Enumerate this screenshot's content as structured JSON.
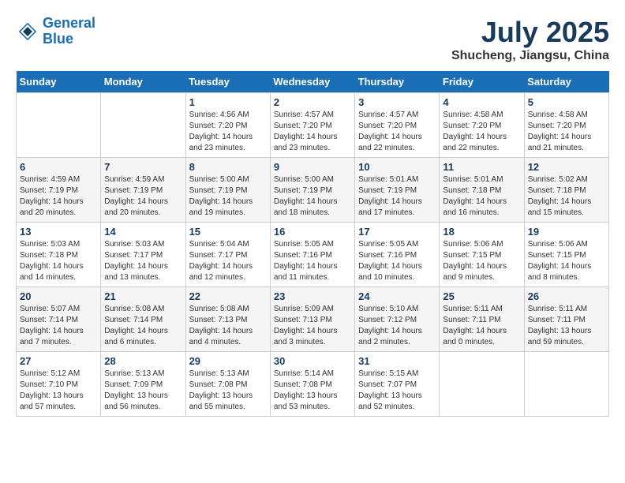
{
  "header": {
    "logo_line1": "General",
    "logo_line2": "Blue",
    "month": "July 2025",
    "location": "Shucheng, Jiangsu, China"
  },
  "days_of_week": [
    "Sunday",
    "Monday",
    "Tuesday",
    "Wednesday",
    "Thursday",
    "Friday",
    "Saturday"
  ],
  "weeks": [
    [
      {
        "day": "",
        "info": ""
      },
      {
        "day": "",
        "info": ""
      },
      {
        "day": "1",
        "info": "Sunrise: 4:56 AM\nSunset: 7:20 PM\nDaylight: 14 hours and 23 minutes."
      },
      {
        "day": "2",
        "info": "Sunrise: 4:57 AM\nSunset: 7:20 PM\nDaylight: 14 hours and 23 minutes."
      },
      {
        "day": "3",
        "info": "Sunrise: 4:57 AM\nSunset: 7:20 PM\nDaylight: 14 hours and 22 minutes."
      },
      {
        "day": "4",
        "info": "Sunrise: 4:58 AM\nSunset: 7:20 PM\nDaylight: 14 hours and 22 minutes."
      },
      {
        "day": "5",
        "info": "Sunrise: 4:58 AM\nSunset: 7:20 PM\nDaylight: 14 hours and 21 minutes."
      }
    ],
    [
      {
        "day": "6",
        "info": "Sunrise: 4:59 AM\nSunset: 7:19 PM\nDaylight: 14 hours and 20 minutes."
      },
      {
        "day": "7",
        "info": "Sunrise: 4:59 AM\nSunset: 7:19 PM\nDaylight: 14 hours and 20 minutes."
      },
      {
        "day": "8",
        "info": "Sunrise: 5:00 AM\nSunset: 7:19 PM\nDaylight: 14 hours and 19 minutes."
      },
      {
        "day": "9",
        "info": "Sunrise: 5:00 AM\nSunset: 7:19 PM\nDaylight: 14 hours and 18 minutes."
      },
      {
        "day": "10",
        "info": "Sunrise: 5:01 AM\nSunset: 7:19 PM\nDaylight: 14 hours and 17 minutes."
      },
      {
        "day": "11",
        "info": "Sunrise: 5:01 AM\nSunset: 7:18 PM\nDaylight: 14 hours and 16 minutes."
      },
      {
        "day": "12",
        "info": "Sunrise: 5:02 AM\nSunset: 7:18 PM\nDaylight: 14 hours and 15 minutes."
      }
    ],
    [
      {
        "day": "13",
        "info": "Sunrise: 5:03 AM\nSunset: 7:18 PM\nDaylight: 14 hours and 14 minutes."
      },
      {
        "day": "14",
        "info": "Sunrise: 5:03 AM\nSunset: 7:17 PM\nDaylight: 14 hours and 13 minutes."
      },
      {
        "day": "15",
        "info": "Sunrise: 5:04 AM\nSunset: 7:17 PM\nDaylight: 14 hours and 12 minutes."
      },
      {
        "day": "16",
        "info": "Sunrise: 5:05 AM\nSunset: 7:16 PM\nDaylight: 14 hours and 11 minutes."
      },
      {
        "day": "17",
        "info": "Sunrise: 5:05 AM\nSunset: 7:16 PM\nDaylight: 14 hours and 10 minutes."
      },
      {
        "day": "18",
        "info": "Sunrise: 5:06 AM\nSunset: 7:15 PM\nDaylight: 14 hours and 9 minutes."
      },
      {
        "day": "19",
        "info": "Sunrise: 5:06 AM\nSunset: 7:15 PM\nDaylight: 14 hours and 8 minutes."
      }
    ],
    [
      {
        "day": "20",
        "info": "Sunrise: 5:07 AM\nSunset: 7:14 PM\nDaylight: 14 hours and 7 minutes."
      },
      {
        "day": "21",
        "info": "Sunrise: 5:08 AM\nSunset: 7:14 PM\nDaylight: 14 hours and 6 minutes."
      },
      {
        "day": "22",
        "info": "Sunrise: 5:08 AM\nSunset: 7:13 PM\nDaylight: 14 hours and 4 minutes."
      },
      {
        "day": "23",
        "info": "Sunrise: 5:09 AM\nSunset: 7:13 PM\nDaylight: 14 hours and 3 minutes."
      },
      {
        "day": "24",
        "info": "Sunrise: 5:10 AM\nSunset: 7:12 PM\nDaylight: 14 hours and 2 minutes."
      },
      {
        "day": "25",
        "info": "Sunrise: 5:11 AM\nSunset: 7:11 PM\nDaylight: 14 hours and 0 minutes."
      },
      {
        "day": "26",
        "info": "Sunrise: 5:11 AM\nSunset: 7:11 PM\nDaylight: 13 hours and 59 minutes."
      }
    ],
    [
      {
        "day": "27",
        "info": "Sunrise: 5:12 AM\nSunset: 7:10 PM\nDaylight: 13 hours and 57 minutes."
      },
      {
        "day": "28",
        "info": "Sunrise: 5:13 AM\nSunset: 7:09 PM\nDaylight: 13 hours and 56 minutes."
      },
      {
        "day": "29",
        "info": "Sunrise: 5:13 AM\nSunset: 7:08 PM\nDaylight: 13 hours and 55 minutes."
      },
      {
        "day": "30",
        "info": "Sunrise: 5:14 AM\nSunset: 7:08 PM\nDaylight: 13 hours and 53 minutes."
      },
      {
        "day": "31",
        "info": "Sunrise: 5:15 AM\nSunset: 7:07 PM\nDaylight: 13 hours and 52 minutes."
      },
      {
        "day": "",
        "info": ""
      },
      {
        "day": "",
        "info": ""
      }
    ]
  ]
}
